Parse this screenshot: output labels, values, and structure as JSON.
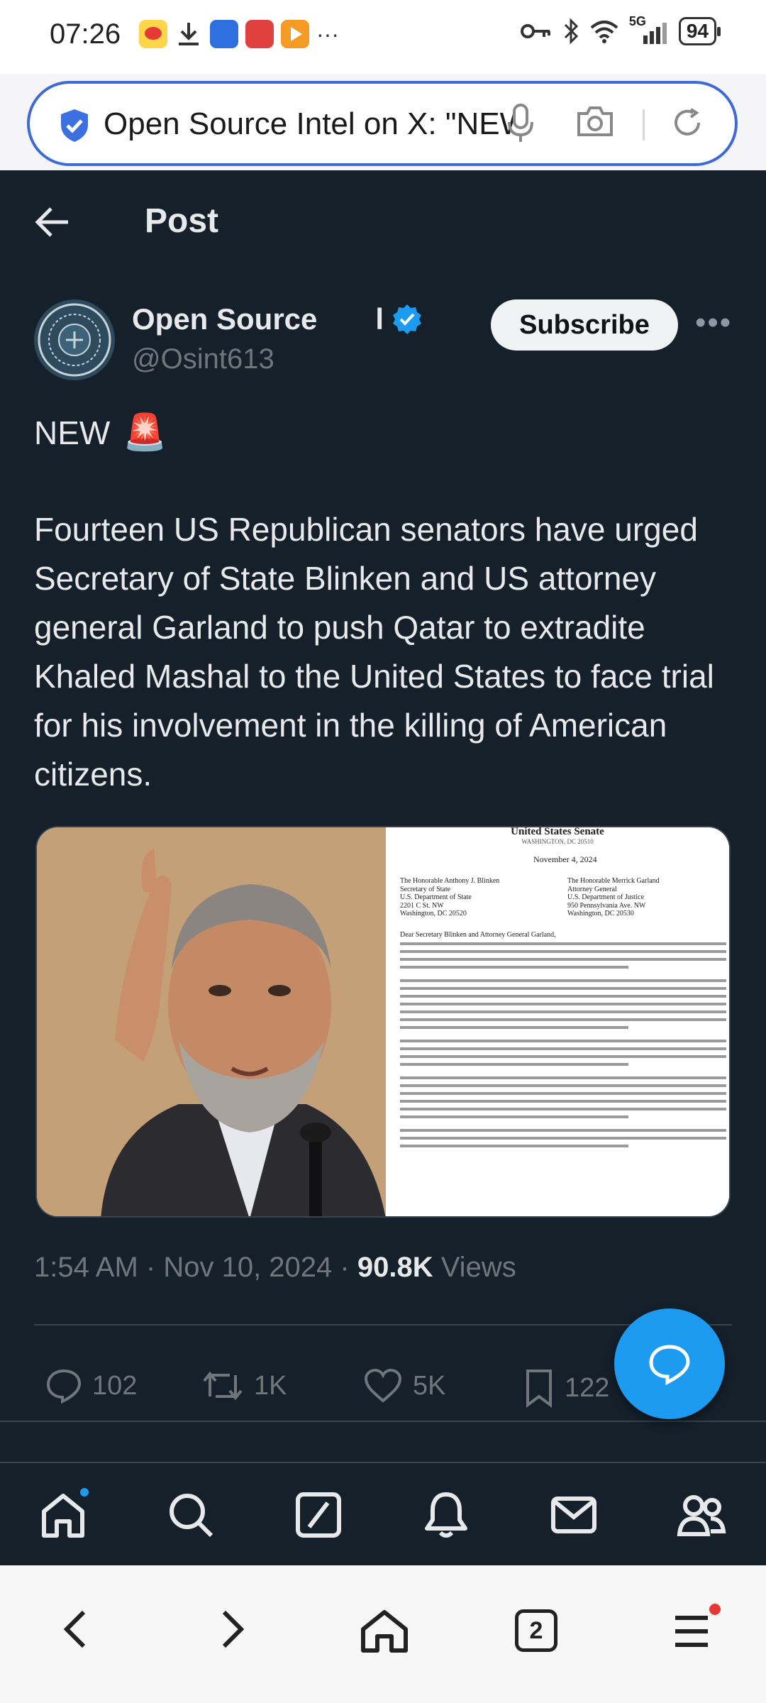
{
  "status_bar": {
    "time": "07:26",
    "network": "5G",
    "battery": "94",
    "overflow": "···"
  },
  "browser": {
    "address_text": "Open Source Intel on X: \"NEW 🚨 Fourteen US Republican senators have urged Secretary of State Blinken",
    "tab_count": "2"
  },
  "header": {
    "title": "Post"
  },
  "author": {
    "display_name": "Open Source",
    "name_tail": "l",
    "handle": "@Osint613",
    "subscribe_label": "Subscribe"
  },
  "post": {
    "tag": "NEW",
    "tag_emoji": "🚨",
    "body": "Fourteen US Republican senators have urged Secretary of State Blinken and US attorney general Garland to push Qatar to extradite Khaled Mashal to the United States to face trial for his involvement in the killing of American citizens.",
    "time": "1:54 AM",
    "date": "Nov 10, 2024",
    "views_count": "90.8K",
    "views_label": "Views"
  },
  "letter": {
    "header": "United States Senate",
    "subheader": "WASHINGTON, DC 20510",
    "date": "November 4, 2024",
    "recipient_left": [
      "The Honorable Anthony J. Blinken",
      "Secretary of State",
      "U.S. Department of State",
      "2201 C St. NW",
      "Washington, DC 20520"
    ],
    "recipient_right": [
      "The Honorable Merrick Garland",
      "Attorney General",
      "U.S. Department of Justice",
      "950 Pennsylvania Ave. NW",
      "Washington, DC 20530"
    ],
    "salutation": "Dear Secretary Blinken and Attorney General Garland,"
  },
  "actions": {
    "replies": "102",
    "reposts": "1K",
    "likes": "5K",
    "bookmarks": "122"
  },
  "colors": {
    "background": "#15202b",
    "accent": "#1d9bf0",
    "text": "#e7e9ea",
    "muted": "#71767b",
    "divider": "#38444d",
    "address_border": "#3d6ad6"
  }
}
